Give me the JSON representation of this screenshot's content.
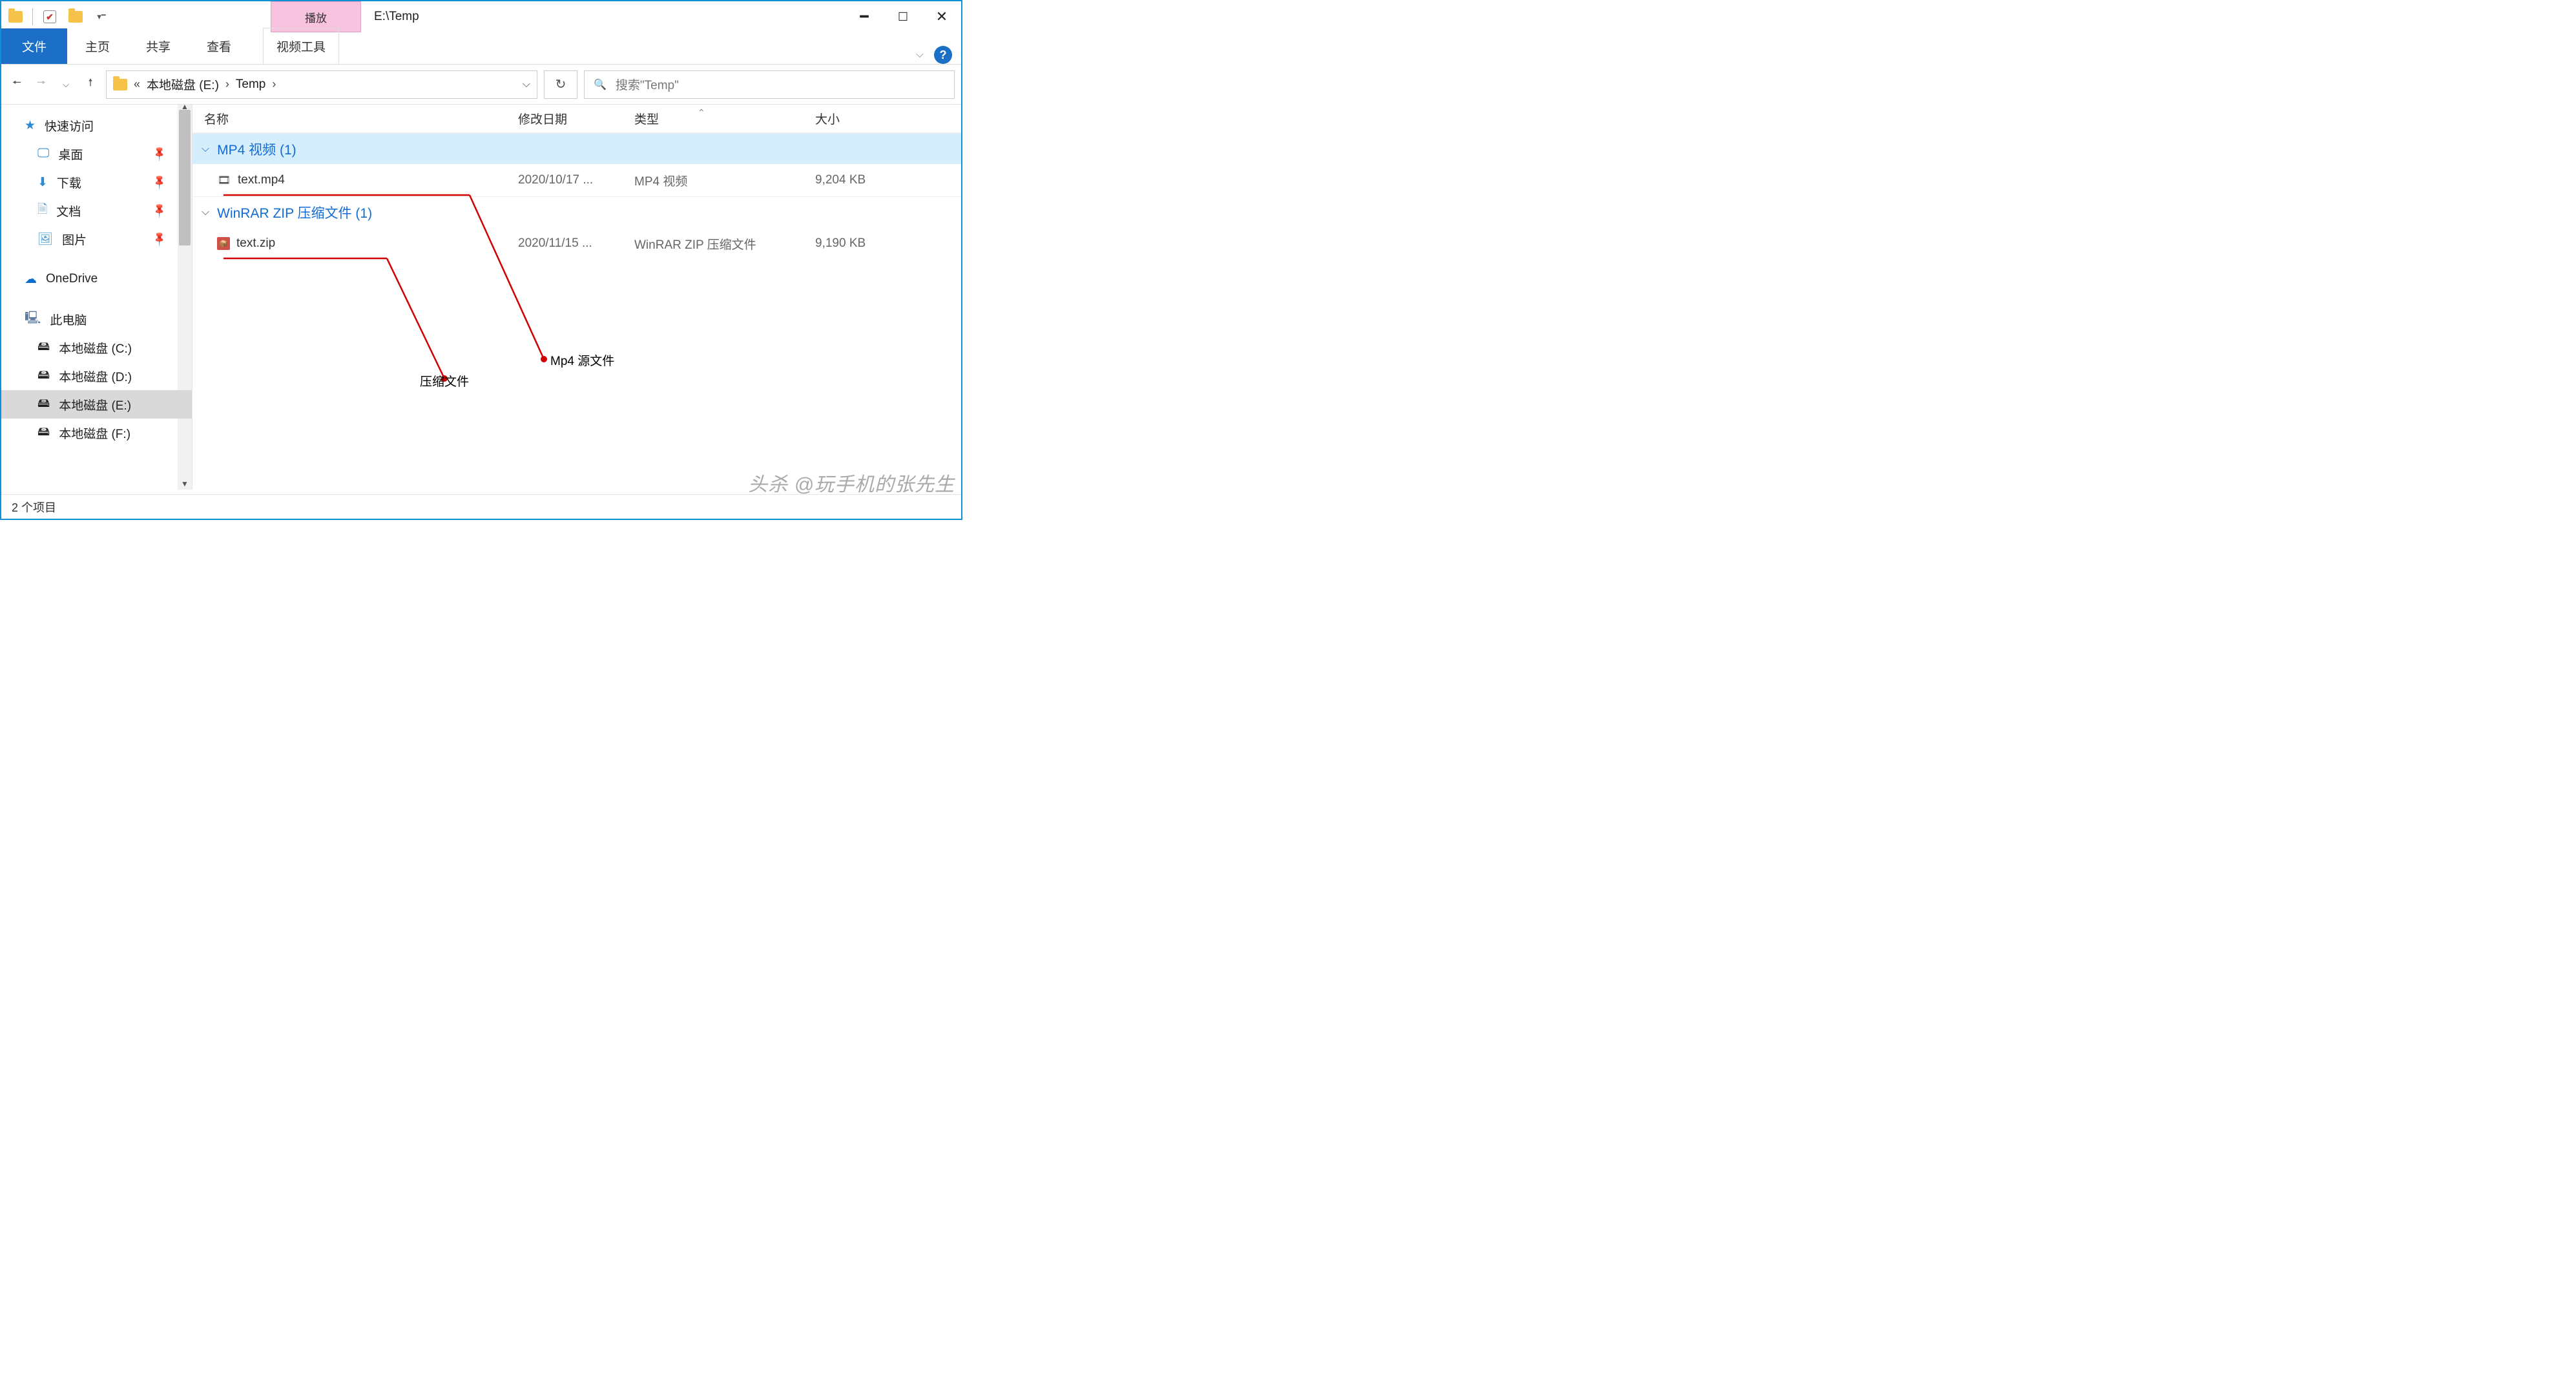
{
  "window": {
    "title": "E:\\Temp",
    "context_tab": "播放",
    "context_tool": "视频工具"
  },
  "ribbon": {
    "file": "文件",
    "home": "主页",
    "share": "共享",
    "view": "查看"
  },
  "nav": {
    "glyph": "«",
    "crumb1": "本地磁盘 (E:)",
    "crumb2": "Temp",
    "search_placeholder": "搜索\"Temp\""
  },
  "columns": {
    "name": "名称",
    "date": "修改日期",
    "type": "类型",
    "size": "大小"
  },
  "sidebar": {
    "quick": "快速访问",
    "desktop": "桌面",
    "downloads": "下载",
    "documents": "文档",
    "pictures": "图片",
    "onedrive": "OneDrive",
    "thispc": "此电脑",
    "driveC": "本地磁盘 (C:)",
    "driveD": "本地磁盘 (D:)",
    "driveE": "本地磁盘 (E:)",
    "driveF": "本地磁盘 (F:)"
  },
  "groups": {
    "g1": "MP4 视频 (1)",
    "g2": "WinRAR ZIP 压缩文件 (1)"
  },
  "files": {
    "f1": {
      "name": "text.mp4",
      "date": "2020/10/17 ...",
      "type": "MP4 视频",
      "size": "9,204 KB"
    },
    "f2": {
      "name": "text.zip",
      "date": "2020/11/15 ...",
      "type": "WinRAR ZIP 压缩文件",
      "size": "9,190 KB"
    }
  },
  "status": "2 个项目",
  "annotations": {
    "mp4_label": "Mp4 源文件",
    "zip_label": "压缩文件"
  },
  "watermark": "头杀 @玩手机的张先生"
}
